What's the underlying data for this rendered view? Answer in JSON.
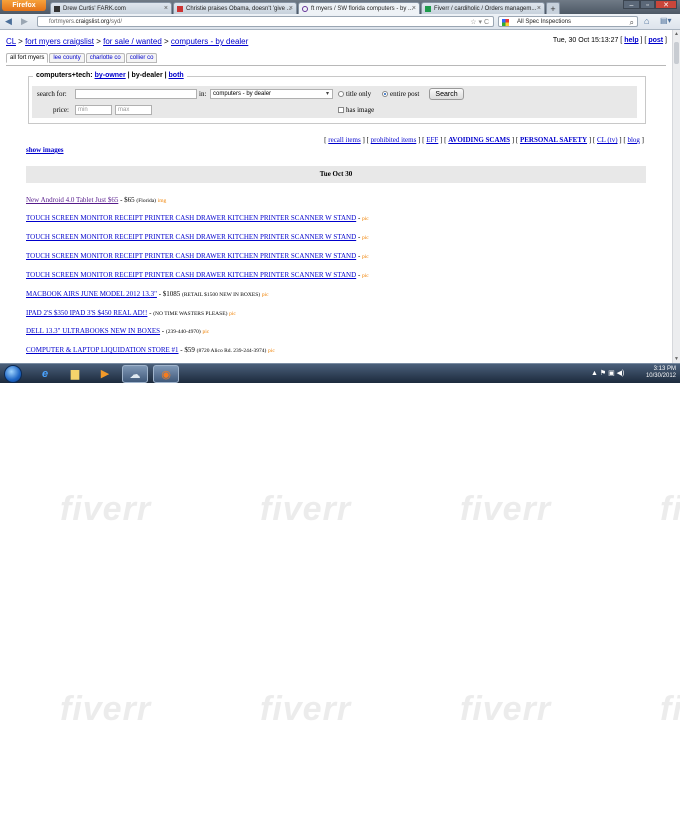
{
  "browser": {
    "menu_label": "Firefox",
    "tabs": [
      {
        "label": "Drew Curtis' FARK.com",
        "active": false
      },
      {
        "label": "Christie praises Obama, doesn't 'give ...",
        "active": false
      },
      {
        "label": "ft myers / SW florida computers - by ...",
        "active": true
      },
      {
        "label": "Fiverr / cardiholic / Orders managem...",
        "active": false
      }
    ],
    "new_tab": "+",
    "url_prefix": "fortmyers.",
    "url_domain": "craigslist.org",
    "url_path": "/syd/",
    "search_text": "All Spec Inspections"
  },
  "page": {
    "breadcrumb": {
      "home": "CL",
      "city": "fort myers craigslist",
      "section": "for sale / wanted",
      "category": "computers - by dealer"
    },
    "datetime": "Tue, 30 Oct 15:13:27",
    "help": "help",
    "post": "post",
    "area_tabs": [
      "all fort myers",
      "lee county",
      "charlotte co",
      "collier co"
    ],
    "search": {
      "legend_prefix": "computers+tech:",
      "by_owner": "by-owner",
      "by_dealer": "by-dealer",
      "both": "both",
      "search_for_label": "search for:",
      "in_label": "in:",
      "category_value": "computers - by dealer",
      "title_only": "title only",
      "entire_post": "entire post",
      "button": "Search",
      "price_label": "price:",
      "min_placeholder": "min",
      "max_placeholder": "max",
      "has_image": "has image"
    },
    "links": {
      "recall": "recall items",
      "prohibited": "prohibited items",
      "eff": "EFF",
      "scams": "AVOIDING SCAMS",
      "safety": "PERSONAL SAFETY",
      "cl_tv": "CL (tv)",
      "blog": "blog"
    },
    "show_images": "show images",
    "date_header": "Tue Oct 30",
    "listings": [
      {
        "title": "New Android 4.0 Tablet Just $65",
        "price": "$65",
        "location": "(Florida)",
        "tag": "img",
        "visited": true
      },
      {
        "title": "TOUCH SCREEN MONITOR RECEIPT PRINTER CASH DRAWER KITCHEN PRINTER SCANNER W STAND",
        "price": "",
        "location": "",
        "tag": "pic",
        "visited": false
      },
      {
        "title": "TOUCH SCREEN MONITOR RECEIPT PRINTER CASH DRAWER KITCHEN PRINTER SCANNER W STAND",
        "price": "",
        "location": "",
        "tag": "pic",
        "visited": false
      },
      {
        "title": "TOUCH SCREEN MONITOR RECEIPT PRINTER CASH DRAWER KITCHEN PRINTER SCANNER W STAND",
        "price": "",
        "location": "",
        "tag": "pic",
        "visited": false
      },
      {
        "title": "TOUCH SCREEN MONITOR RECEIPT PRINTER CASH DRAWER KITCHEN PRINTER SCANNER W STAND",
        "price": "",
        "location": "",
        "tag": "pic",
        "visited": false
      },
      {
        "title": "MACBOOK AIRS JUNE MODEL 2012 13.3\"",
        "price": "$1085",
        "location": "(RETAIL $1500 NEW IN BOXES)",
        "tag": "pic",
        "visited": false
      },
      {
        "title": "IPAD 2'S $350 IPAD 3'S $450 REAL AD!!",
        "price": "",
        "location": "(NO TIME WASTERS PLEASE)",
        "tag": "pic",
        "visited": false
      },
      {
        "title": "DELL 13.3\" ULTRABOOKS NEW IN BOXES",
        "price": "",
        "location": "(239-440-4970)",
        "tag": "pic",
        "visited": false
      },
      {
        "title": "COMPUTER & LAPTOP LIQUIDATION STORE #1",
        "price": "$59",
        "location": "(8720 Alico Rd. 239-244-3974)",
        "tag": "pic",
        "visited": false
      }
    ]
  },
  "watermark": "fiverr",
  "taskbar": {
    "time": "3:13 PM",
    "date": "10/30/2012"
  }
}
